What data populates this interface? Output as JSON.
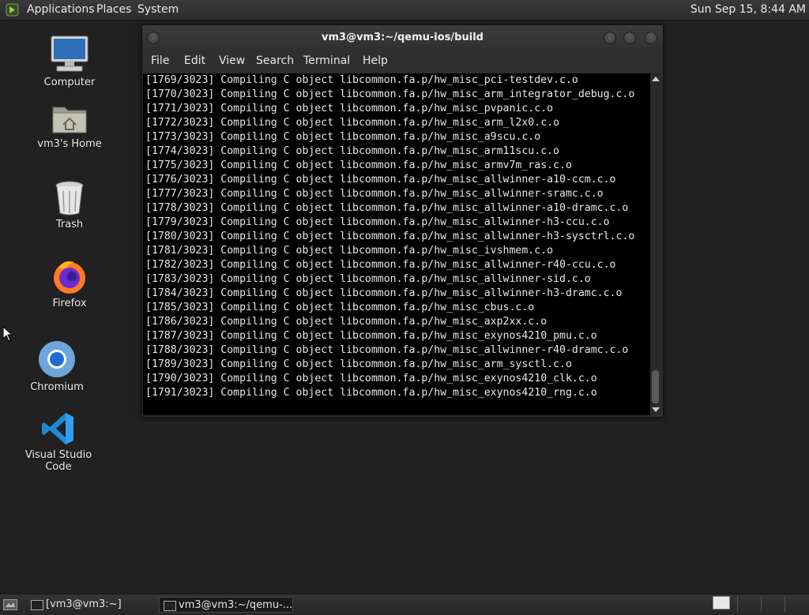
{
  "top_panel": {
    "menus": [
      "Applications",
      "Places",
      "System"
    ],
    "clock": "Sun Sep 15,  8:44 AM"
  },
  "desktop": {
    "icons": [
      {
        "label": "Computer",
        "icon": "computer-icon"
      },
      {
        "label": "vm3's Home",
        "icon": "home-folder-icon"
      },
      {
        "label": "Trash",
        "icon": "trash-icon"
      },
      {
        "label": "Firefox",
        "icon": "firefox-icon"
      },
      {
        "label": "Chromium",
        "icon": "chromium-icon"
      },
      {
        "label": "Visual Studio Code",
        "icon": "vscode-icon"
      }
    ]
  },
  "terminal": {
    "title": "vm3@vm3:~/qemu-ios/build",
    "menu": [
      "File",
      "Edit",
      "View",
      "Search",
      "Terminal",
      "Help"
    ],
    "lines": [
      "[1769/3023] Compiling C object libcommon.fa.p/hw_misc_pci-testdev.c.o",
      "[1770/3023] Compiling C object libcommon.fa.p/hw_misc_arm_integrator_debug.c.o",
      "[1771/3023] Compiling C object libcommon.fa.p/hw_misc_pvpanic.c.o",
      "[1772/3023] Compiling C object libcommon.fa.p/hw_misc_arm_l2x0.c.o",
      "[1773/3023] Compiling C object libcommon.fa.p/hw_misc_a9scu.c.o",
      "[1774/3023] Compiling C object libcommon.fa.p/hw_misc_arm11scu.c.o",
      "[1775/3023] Compiling C object libcommon.fa.p/hw_misc_armv7m_ras.c.o",
      "[1776/3023] Compiling C object libcommon.fa.p/hw_misc_allwinner-a10-ccm.c.o",
      "[1777/3023] Compiling C object libcommon.fa.p/hw_misc_allwinner-sramc.c.o",
      "[1778/3023] Compiling C object libcommon.fa.p/hw_misc_allwinner-a10-dramc.c.o",
      "[1779/3023] Compiling C object libcommon.fa.p/hw_misc_allwinner-h3-ccu.c.o",
      "[1780/3023] Compiling C object libcommon.fa.p/hw_misc_allwinner-h3-sysctrl.c.o",
      "[1781/3023] Compiling C object libcommon.fa.p/hw_misc_ivshmem.c.o",
      "[1782/3023] Compiling C object libcommon.fa.p/hw_misc_allwinner-r40-ccu.c.o",
      "[1783/3023] Compiling C object libcommon.fa.p/hw_misc_allwinner-sid.c.o",
      "[1784/3023] Compiling C object libcommon.fa.p/hw_misc_allwinner-h3-dramc.c.o",
      "[1785/3023] Compiling C object libcommon.fa.p/hw_misc_cbus.c.o",
      "[1786/3023] Compiling C object libcommon.fa.p/hw_misc_axp2xx.c.o",
      "[1787/3023] Compiling C object libcommon.fa.p/hw_misc_exynos4210_pmu.c.o",
      "[1788/3023] Compiling C object libcommon.fa.p/hw_misc_allwinner-r40-dramc.c.o",
      "[1789/3023] Compiling C object libcommon.fa.p/hw_misc_arm_sysctl.c.o",
      "[1790/3023] Compiling C object libcommon.fa.p/hw_misc_exynos4210_clk.c.o",
      "[1791/3023] Compiling C object libcommon.fa.p/hw_misc_exynos4210_rng.c.o"
    ]
  },
  "taskbar": {
    "tasks": [
      {
        "label": "[vm3@vm3:~]",
        "active": false
      },
      {
        "label": "vm3@vm3:~/qemu-...",
        "active": true
      }
    ]
  }
}
